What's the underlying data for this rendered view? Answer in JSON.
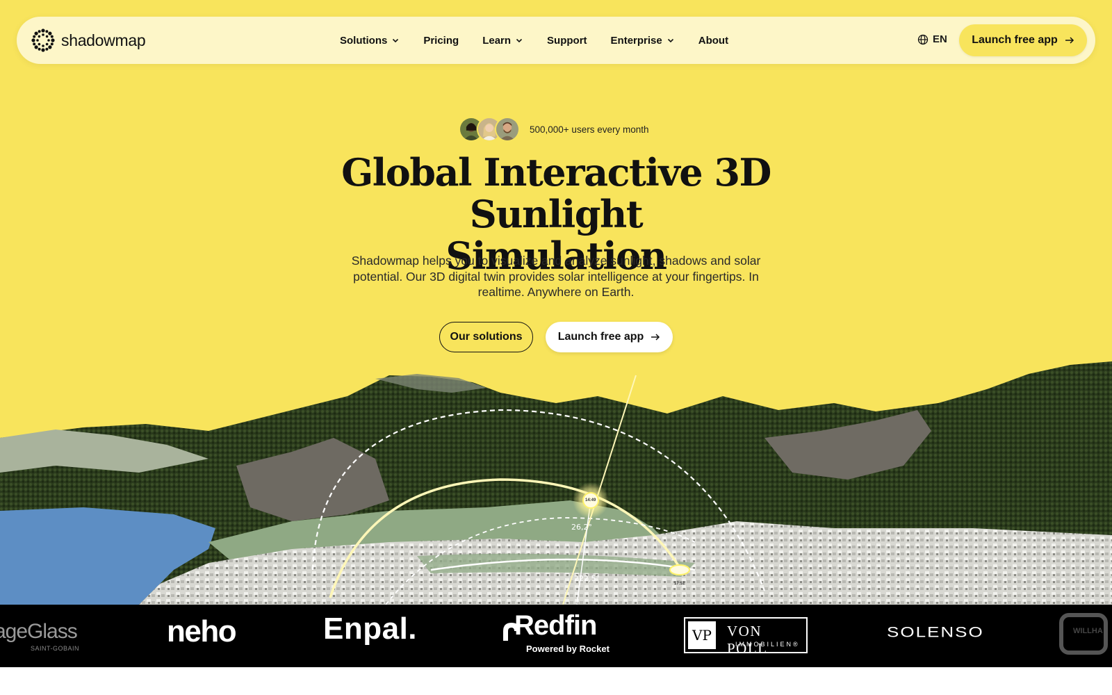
{
  "nav": {
    "brand": "shadowmap",
    "items": [
      {
        "label": "Solutions",
        "has_dropdown": true
      },
      {
        "label": "Pricing",
        "has_dropdown": false
      },
      {
        "label": "Learn",
        "has_dropdown": true
      },
      {
        "label": "Support",
        "has_dropdown": false
      },
      {
        "label": "Enterprise",
        "has_dropdown": true
      },
      {
        "label": "About",
        "has_dropdown": false
      }
    ],
    "language": "EN",
    "cta": "Launch free app"
  },
  "hero": {
    "users_text": "500,000+ users every month",
    "headline_line1": "Global Interactive 3D Sunlight",
    "headline_line2": "Simulation",
    "subtitle": "Shadowmap helps you to visualize and analyze sunlight, shadows and solar potential. Our 3D digital twin provides solar intelligence at your fingertips. In realtime. Anywhere on Earth.",
    "secondary_button": "Our solutions",
    "primary_button": "Launch free app"
  },
  "scene": {
    "sun_time": "14:49",
    "sun_elevation": "26,2°",
    "sun_azimuth": "222,5°",
    "sunset_time": "17:51"
  },
  "partners": {
    "sageglass": "ageGlass",
    "sageglass_sub": "SAINT-GOBAIN",
    "neho": "neho",
    "enpal": "Enpal.",
    "redfin": "Redfin",
    "redfin_sub": "Powered by Rocket",
    "vonpoll_mark": "VP",
    "vonpoll": "VON POLL",
    "vonpoll_sub": "IMMOBILIEN®",
    "solenso": "SOLENSO",
    "willhaben": "WILLHA"
  },
  "colors": {
    "accent_yellow": "#f8e45c",
    "nav_background": "#fdf6c8",
    "strip_background": "#000000"
  },
  "icons": [
    "shadowmap-logo-icon",
    "chevron-down-icon",
    "globe-icon",
    "arrow-right-icon"
  ]
}
